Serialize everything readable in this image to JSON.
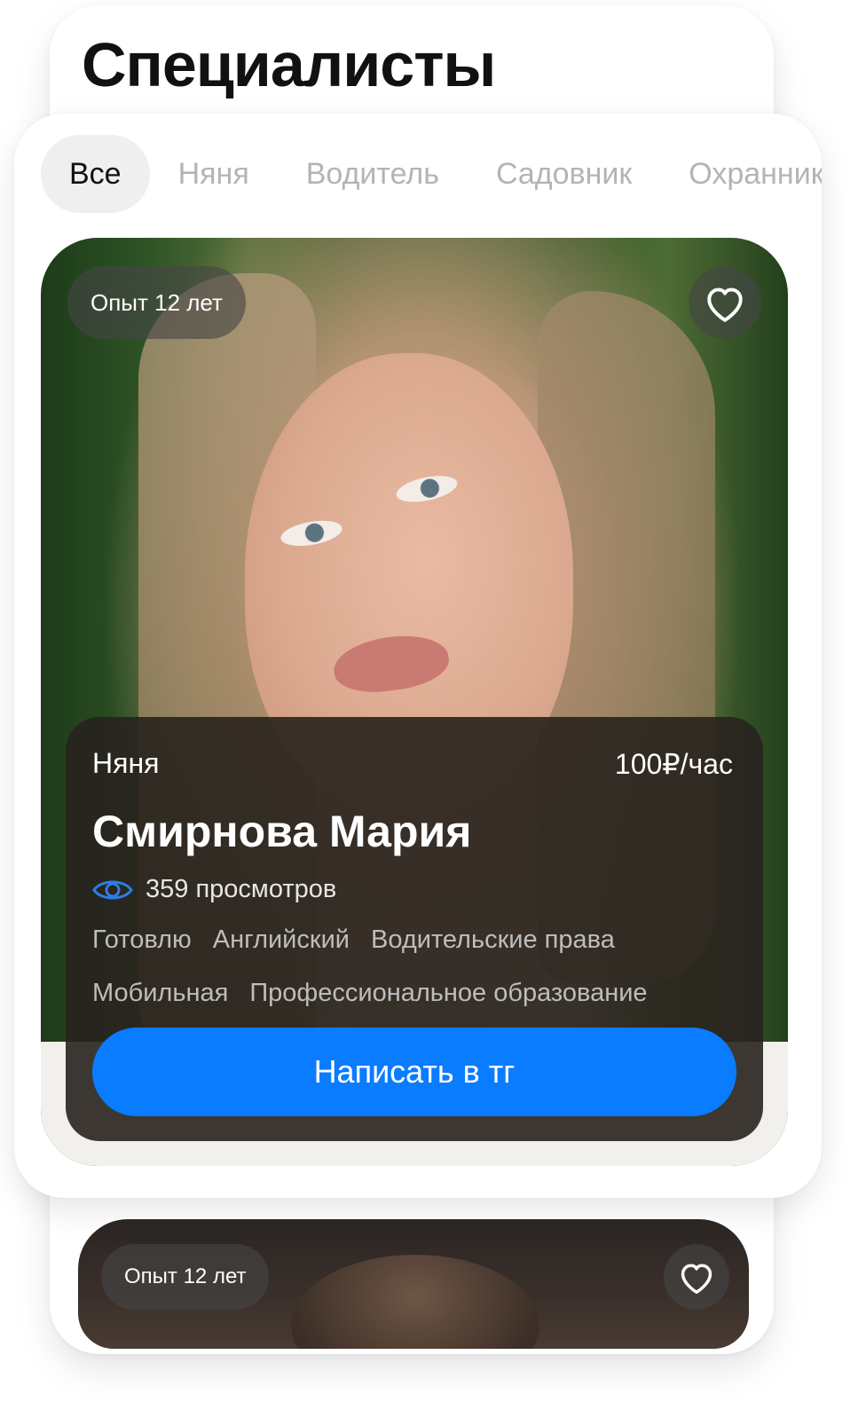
{
  "page": {
    "title": "Специалисты"
  },
  "tabs": [
    {
      "label": "Все",
      "active": true
    },
    {
      "label": "Няня",
      "active": false
    },
    {
      "label": "Водитель",
      "active": false
    },
    {
      "label": "Садовник",
      "active": false
    },
    {
      "label": "Охранник",
      "active": false
    }
  ],
  "cards": [
    {
      "experience": "Опыт 12 лет",
      "role": "Няня",
      "price": "100₽/час",
      "name": "Смирнова Мария",
      "views": "359 просмотров",
      "tags": [
        "Готовлю",
        "Английский",
        "Водительские права",
        "Мобильная",
        "Профессиональное образование"
      ],
      "cta": "Написать в тг",
      "favorited": false
    },
    {
      "experience": "Опыт 12 лет",
      "favorited": false
    }
  ],
  "icons": {
    "favorite": "heart-outline-icon",
    "views": "eye-icon"
  },
  "colors": {
    "accent": "#0a7cff",
    "eye_icon": "#2d7de6",
    "active_tab_bg": "#efefef",
    "inactive_tab_text": "#b4b4b4",
    "panel_bg": "#28221e"
  }
}
